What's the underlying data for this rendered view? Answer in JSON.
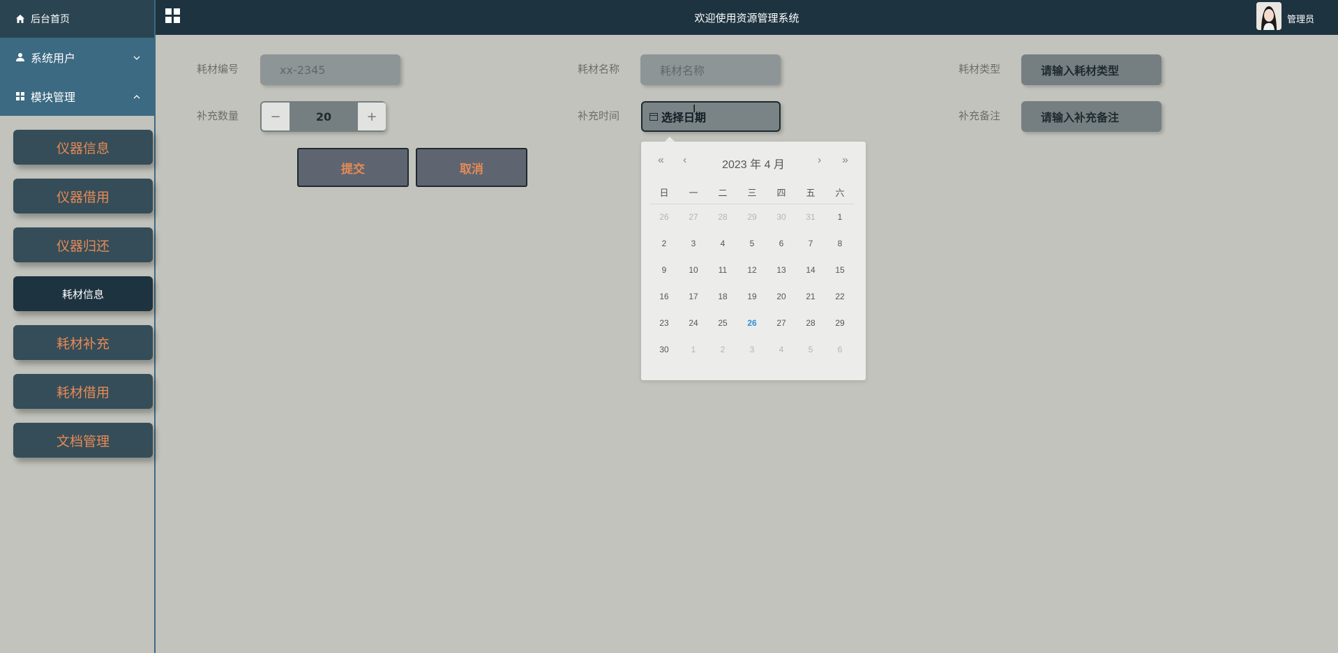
{
  "header": {
    "title": "欢迎使用资源管理系统",
    "user": "管理员"
  },
  "sidebar": {
    "home": "后台首页",
    "groups": [
      {
        "label": "系统用户",
        "chevron": "chevron-down-icon"
      },
      {
        "label": "模块管理",
        "chevron": "chevron-up-icon"
      }
    ],
    "menu": [
      {
        "label": "仪器信息",
        "active": false
      },
      {
        "label": "仪器借用",
        "active": false
      },
      {
        "label": "仪器归还",
        "active": false
      },
      {
        "label": "耗材信息",
        "active": true
      },
      {
        "label": "耗材补充",
        "active": false
      },
      {
        "label": "耗材借用",
        "active": false
      },
      {
        "label": "文档管理",
        "active": false
      }
    ]
  },
  "form": {
    "code_label": "耗材编号",
    "code_value": "xx-2345",
    "name_label": "耗材名称",
    "name_placeholder": "耗材名称",
    "type_label": "耗材类型",
    "type_placeholder": "请输入耗材类型",
    "qty_label": "补充数量",
    "qty_value": "20",
    "minus": "−",
    "plus": "+",
    "time_label": "补充时间",
    "time_placeholder": "选择日期",
    "remark_label": "补充备注",
    "remark_placeholder": "请输入补充备注",
    "submit": "提交",
    "cancel": "取消"
  },
  "datepicker": {
    "header": "2023 年  4 月",
    "nav": {
      "prev_year": "«",
      "prev_month": "‹",
      "next_month": "›",
      "next_year": "»"
    },
    "weekdays": [
      "日",
      "一",
      "二",
      "三",
      "四",
      "五",
      "六"
    ],
    "weeks": [
      [
        "26",
        "27",
        "28",
        "29",
        "30",
        "31",
        "1"
      ],
      [
        "2",
        "3",
        "4",
        "5",
        "6",
        "7",
        "8"
      ],
      [
        "9",
        "10",
        "11",
        "12",
        "13",
        "14",
        "15"
      ],
      [
        "16",
        "17",
        "18",
        "19",
        "20",
        "21",
        "22"
      ],
      [
        "23",
        "24",
        "25",
        "26",
        "27",
        "28",
        "29"
      ],
      [
        "30",
        "1",
        "2",
        "3",
        "4",
        "5",
        "6"
      ]
    ],
    "today": "26",
    "colors": {
      "today": "#2e8fd6"
    }
  }
}
